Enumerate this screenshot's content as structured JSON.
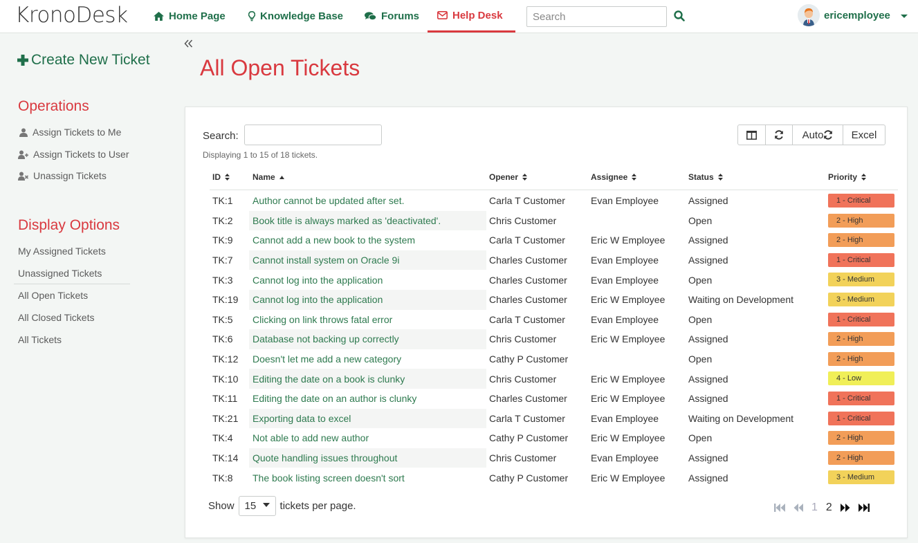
{
  "app": {
    "logo_part1": "Krono",
    "logo_part2": "Desk"
  },
  "nav": {
    "home": "Home Page",
    "kb": "Knowledge Base",
    "forums": "Forums",
    "helpdesk": "Help Desk",
    "search_placeholder": "Search",
    "username": "ericemployee"
  },
  "sidebar": {
    "create": "Create New Ticket",
    "operations_title": "Operations",
    "operations": [
      "Assign Tickets to Me",
      "Assign Tickets to User",
      "Unassign Tickets"
    ],
    "display_title": "Display Options",
    "display": [
      "My Assigned Tickets",
      "Unassigned Tickets",
      "All Open Tickets",
      "All Closed Tickets",
      "All Tickets"
    ]
  },
  "main": {
    "title": "All Open Tickets",
    "search_label": "Search:",
    "displaying": "Displaying 1 to 15 of 18 tickets.",
    "btn_auto": "Auto",
    "btn_excel": "Excel",
    "show_label": "Show",
    "per_page_value": "15",
    "per_page_suffix": "tickets per page.",
    "pages": [
      "1",
      "2"
    ]
  },
  "table": {
    "headers": {
      "id": "ID",
      "name": "Name",
      "opener": "Opener",
      "assignee": "Assignee",
      "status": "Status",
      "priority": "Priority"
    },
    "rows": [
      {
        "id": "TK:1",
        "name": "Author cannot be updated after set.",
        "opener": "Carla T Customer",
        "assignee": "Evan Employee",
        "status": "Assigned",
        "priority": "1 - Critical"
      },
      {
        "id": "TK:2",
        "name": "Book title is always marked as 'deactivated'.",
        "opener": "Chris Customer",
        "assignee": "",
        "status": "Open",
        "priority": "2 - High"
      },
      {
        "id": "TK:9",
        "name": "Cannot add a new book to the system",
        "opener": "Carla T Customer",
        "assignee": "Eric W Employee",
        "status": "Assigned",
        "priority": "2 - High"
      },
      {
        "id": "TK:7",
        "name": "Cannot install system on Oracle 9i",
        "opener": "Charles Customer",
        "assignee": "Evan Employee",
        "status": "Assigned",
        "priority": "1 - Critical"
      },
      {
        "id": "TK:3",
        "name": "Cannot log into the application",
        "opener": "Charles Customer",
        "assignee": "Evan Employee",
        "status": "Open",
        "priority": "3 - Medium"
      },
      {
        "id": "TK:19",
        "name": "Cannot log into the application",
        "opener": "Charles Customer",
        "assignee": "Eric W Employee",
        "status": "Waiting on Development",
        "priority": "3 - Medium"
      },
      {
        "id": "TK:5",
        "name": "Clicking on link throws fatal error",
        "opener": "Carla T Customer",
        "assignee": "Evan Employee",
        "status": "Open",
        "priority": "1 - Critical"
      },
      {
        "id": "TK:6",
        "name": "Database not backing up correctly",
        "opener": "Chris Customer",
        "assignee": "Eric W Employee",
        "status": "Assigned",
        "priority": "2 - High"
      },
      {
        "id": "TK:12",
        "name": "Doesn't let me add a new category",
        "opener": "Cathy P Customer",
        "assignee": "",
        "status": "Open",
        "priority": "2 - High"
      },
      {
        "id": "TK:10",
        "name": "Editing the date on a book is clunky",
        "opener": "Chris Customer",
        "assignee": "Eric W Employee",
        "status": "Assigned",
        "priority": "4 - Low"
      },
      {
        "id": "TK:11",
        "name": "Editing the date on an author is clunky",
        "opener": "Charles Customer",
        "assignee": "Eric W Employee",
        "status": "Assigned",
        "priority": "1 - Critical"
      },
      {
        "id": "TK:21",
        "name": "Exporting data to excel",
        "opener": "Carla T Customer",
        "assignee": "Evan Employee",
        "status": "Waiting on Development",
        "priority": "1 - Critical"
      },
      {
        "id": "TK:4",
        "name": "Not able to add new author",
        "opener": "Cathy P Customer",
        "assignee": "Eric W Employee",
        "status": "Open",
        "priority": "2 - High"
      },
      {
        "id": "TK:14",
        "name": "Quote handling issues throughout",
        "opener": "Chris Customer",
        "assignee": "Evan Employee",
        "status": "Assigned",
        "priority": "2 - High"
      },
      {
        "id": "TK:8",
        "name": "The book listing screen doesn't sort",
        "opener": "Cathy P Customer",
        "assignee": "Eric W Employee",
        "status": "Assigned",
        "priority": "3 - Medium"
      }
    ]
  },
  "colors": {
    "accent": "#d9393f",
    "link": "#2e7a4f",
    "nav": "#1f6f4a",
    "critical": "#f0735a",
    "high": "#f29d58",
    "medium": "#f2d25a",
    "low": "#f0ef58"
  }
}
